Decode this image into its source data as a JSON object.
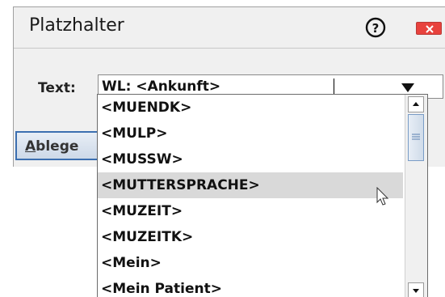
{
  "dialog": {
    "title": "Platzhalter",
    "help_icon": "question-circle-icon",
    "close_icon": "close-x-icon",
    "close_color": "#e8423d"
  },
  "form": {
    "text_label": "Text:",
    "combo_value": "WL: <Ankunft>",
    "combo_arrow_icon": "dropdown-arrow-icon",
    "action_button_label": "Ablege"
  },
  "dropdown": {
    "highlight_color": "#d9d9d9",
    "options": [
      "<MUENDK>",
      "<MULP>",
      "<MUSSW>",
      "<MUTTERSPRACHE>",
      "<MUZEIT>",
      "<MUZEITK>",
      "<Mein>",
      "<Mein Patient>"
    ],
    "highlighted_option": "<MUTTERSPRACHE>"
  }
}
